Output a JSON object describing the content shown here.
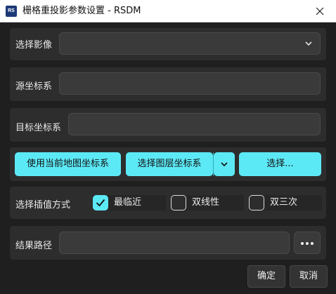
{
  "window": {
    "title": "栅格重投影参数设置 - RSDM",
    "icon_text": "RS",
    "close_icon": "close-icon"
  },
  "image_select": {
    "label": "选择影像",
    "value": ""
  },
  "source_crs": {
    "label": "源坐标系",
    "value": ""
  },
  "target_crs": {
    "label": "目标坐标系",
    "value": ""
  },
  "crs_buttons": {
    "use_map_crs": "使用当前地图坐标系",
    "select_layer_crs": "选择图层坐标系",
    "select": "选择..."
  },
  "interpolation": {
    "label": "选择插值方式",
    "options": [
      {
        "label": "最临近",
        "checked": true
      },
      {
        "label": "双线性",
        "checked": false
      },
      {
        "label": "双三次",
        "checked": false
      }
    ]
  },
  "output": {
    "label": "结果路径",
    "value": "",
    "browse_icon": "ellipsis-icon"
  },
  "footer": {
    "ok": "确定",
    "cancel": "取消"
  },
  "colors": {
    "accent": "#5ce9f6",
    "background": "#1f1f1f",
    "panel": "#2d2d2d"
  }
}
